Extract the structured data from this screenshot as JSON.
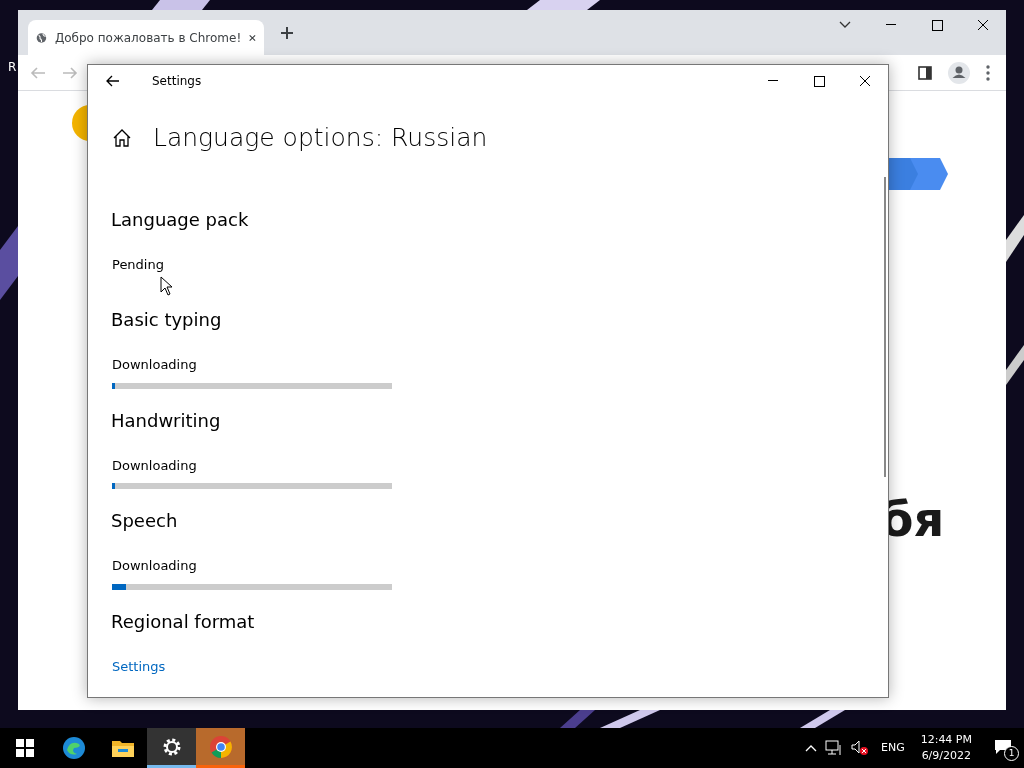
{
  "desktop": {
    "icon_label": "R"
  },
  "browser": {
    "tab": {
      "title": "Добро пожаловать в Chrome!",
      "selected": true
    },
    "page_text": "бя"
  },
  "settings": {
    "title": "Settings",
    "heading": "Language options: Russian",
    "sections": [
      {
        "kind": "status",
        "title": "Language pack",
        "status": "Pending"
      },
      {
        "kind": "progress",
        "title": "Basic typing",
        "status": "Downloading",
        "level": 0.01
      },
      {
        "kind": "progress",
        "title": "Handwriting",
        "status": "Downloading",
        "level": 0.01
      },
      {
        "kind": "progress",
        "title": "Speech",
        "status": "Downloading",
        "level": 0.05
      },
      {
        "kind": "link",
        "title": "Regional format",
        "link": "Settings"
      }
    ]
  },
  "taskbar": {
    "apps": [
      {
        "kind": "edge",
        "active": false,
        "attention": false
      },
      {
        "kind": "explorer",
        "active": false,
        "attention": false
      },
      {
        "kind": "settings",
        "active": true,
        "attention": false
      },
      {
        "kind": "chrome",
        "active": false,
        "attention": true
      }
    ],
    "language": "ENG",
    "time": "12:44 PM",
    "date": "6/9/2022",
    "notifications": "1"
  }
}
